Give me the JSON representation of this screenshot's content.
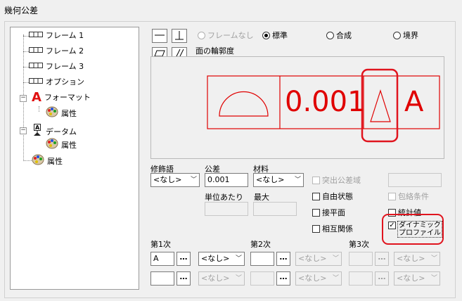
{
  "dialog_title": "幾何公差",
  "tree": {
    "items": [
      {
        "label": "フレーム 1",
        "icon": "frame-icon"
      },
      {
        "label": "フレーム 2",
        "icon": "frame-icon"
      },
      {
        "label": "フレーム 3",
        "icon": "frame-icon"
      },
      {
        "label": "オプション",
        "icon": "frame-icon"
      },
      {
        "label": "フォーマット",
        "icon": "format-a-icon"
      },
      {
        "label": "属性",
        "icon": "palette-icon"
      },
      {
        "label": "データム",
        "icon": "datum-icon"
      },
      {
        "label": "属性",
        "icon": "palette-icon"
      },
      {
        "label": "属性",
        "icon": "palette-icon"
      }
    ]
  },
  "frame_mode": {
    "options": [
      "フレームなし",
      "標準",
      "合成",
      "境界"
    ],
    "selected": "標準"
  },
  "selected_symbol_name": "面の輪郭度",
  "preview": {
    "tolerance": "0.001",
    "datum": "A",
    "color": "#e00000"
  },
  "fields": {
    "modifier_label": "修飾語",
    "modifier_value": "<なし>",
    "tolerance_label": "公差",
    "tolerance_value": "0.001",
    "material_label": "材料",
    "material_value": "<なし>",
    "per_unit_label": "単位あたり",
    "max_label": "最大"
  },
  "checks": {
    "projected_zone": {
      "label": "突出公差域",
      "checked": false
    },
    "free_state": {
      "label": "自由状態",
      "checked": false
    },
    "envelope": {
      "label": "包絡条件",
      "checked": false
    },
    "tangent_plane": {
      "label": "接平面",
      "checked": false
    },
    "statistical": {
      "label": "統計値",
      "checked": false
    },
    "interrelation": {
      "label": "相互関係",
      "checked": false
    },
    "dynamic_profile_line1": "ダイナミック",
    "dynamic_profile_line2": "プロファイル",
    "dynamic_profile_checked": true
  },
  "datums": {
    "primary_label": "第1次",
    "secondary_label": "第2次",
    "tertiary_label": "第3次",
    "primary_value": "A",
    "dots": "…",
    "none": "<なし>"
  },
  "highlight_color": "#e0141e"
}
